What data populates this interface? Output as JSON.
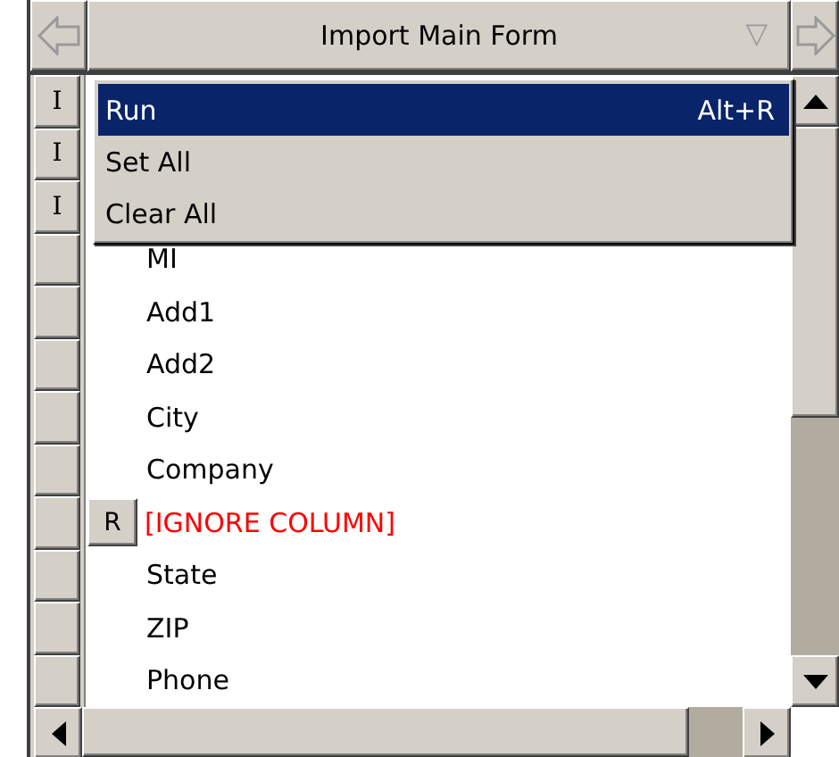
{
  "header": {
    "title": "Import Main Form",
    "dropdown": "▽"
  },
  "rows": [
    {
      "tag": "I"
    },
    {
      "tag": "I"
    },
    {
      "tag": "I"
    },
    {
      "field": "MI",
      "kind": "normal"
    },
    {
      "field": "Add1",
      "kind": "normal"
    },
    {
      "field": "Add2",
      "kind": "normal"
    },
    {
      "field": "City",
      "kind": "normal"
    },
    {
      "field": "Company",
      "kind": "normal"
    },
    {
      "field": "[IGNORE COLUMN]",
      "kind": "ignored",
      "flag": "R"
    },
    {
      "field": "State",
      "kind": "normal"
    },
    {
      "field": "ZIP",
      "kind": "normal"
    },
    {
      "field": "Phone",
      "kind": "normal"
    }
  ],
  "menu": [
    {
      "label": "Run",
      "shortcut": "Alt+R",
      "selected": true
    },
    {
      "label": "Set All",
      "selected": false
    },
    {
      "label": "Clear All",
      "selected": false
    }
  ]
}
